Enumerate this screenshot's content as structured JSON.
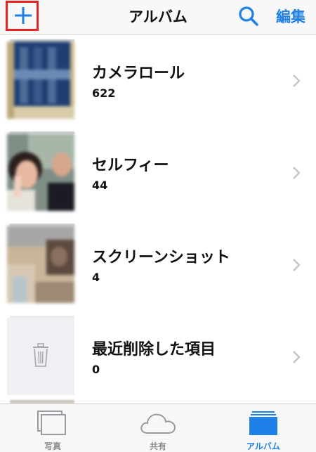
{
  "navbar": {
    "title": "アルバム",
    "edit_label": "編集",
    "add_icon": "plus-icon",
    "search_icon": "search-icon",
    "highlight_color": "#e52426",
    "accent_color": "#1e7fe6"
  },
  "albums": [
    {
      "name": "カメラロール",
      "count": "622"
    },
    {
      "name": "セルフィー",
      "count": "44"
    },
    {
      "name": "スクリーンショット",
      "count": "4"
    },
    {
      "name": "最近削除した項目",
      "count": "0"
    }
  ],
  "tabbar": {
    "tabs": [
      {
        "label": "写真",
        "icon": "photos-icon",
        "active": false
      },
      {
        "label": "共有",
        "icon": "cloud-icon",
        "active": false
      },
      {
        "label": "アルバム",
        "icon": "albums-icon",
        "active": true
      }
    ]
  }
}
